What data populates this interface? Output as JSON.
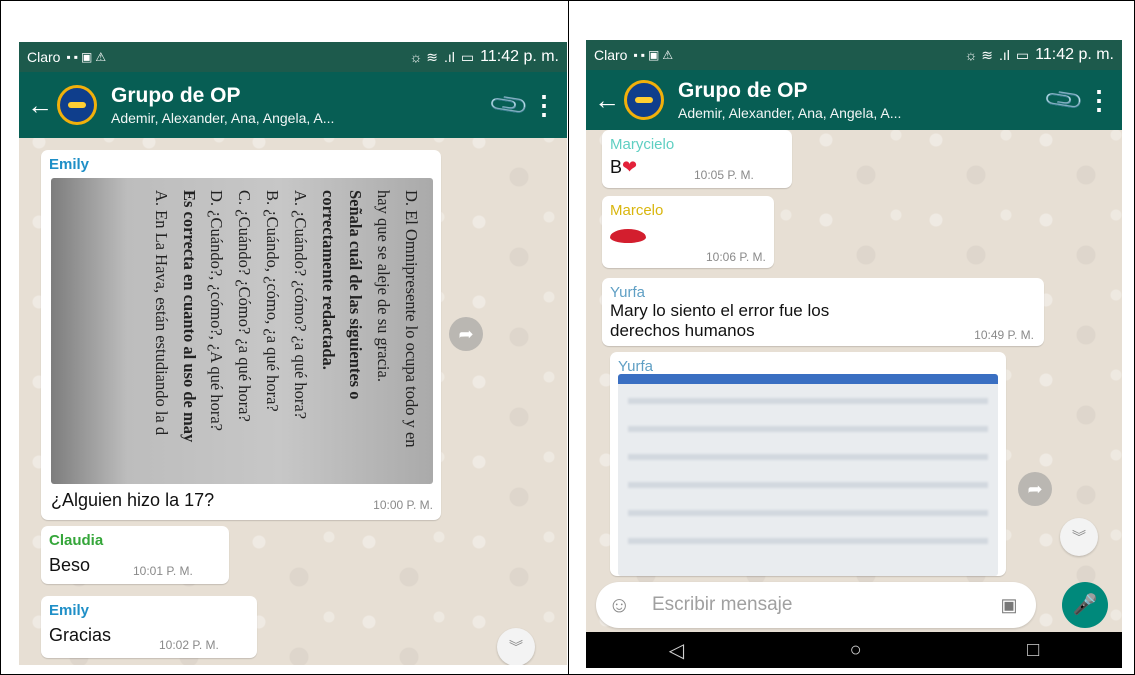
{
  "left": {
    "status": {
      "carrier": "Claro",
      "time": "11:42 p. m."
    },
    "header": {
      "title": "Grupo de OP",
      "subtitle": "Ademir, Alexander, Ana, Angela, A..."
    },
    "messages": [
      {
        "sender": "Emily",
        "sender_color": "#1f8fc7",
        "text": "¿Alguien hizo la 17?",
        "time": "10:00 P. M.",
        "image_lines": [
          "D.  El Omnipresente lo ocupa todo y en",
          "       hay que se aleje de su gracia.",
          "Señala cuál de las siguientes o",
          "correctamente redactada.",
          "A.  ¿Cuándo? ¿cómo? ¿a qué hora?",
          "B.  ¿Cuándo, ¿cómo, ¿a qué hora?",
          "C.  ¿Cuándo? ¿Cómo? ¿a qué hora?",
          "D.  ¿Cuándo?, ¿cómo?, ¿A qué hora?",
          "Es correcta en cuanto al uso de may",
          "A.  En La Hava, están estudiando la d"
        ]
      },
      {
        "sender": "Claudia",
        "sender_color": "#35a63a",
        "text": "Beso",
        "time": "10:01 P. M."
      },
      {
        "sender": "Emily",
        "sender_color": "#1f8fc7",
        "text": "Gracias",
        "time": "10:02 P. M."
      }
    ]
  },
  "right": {
    "status": {
      "carrier": "Claro",
      "time": "11:42 p. m."
    },
    "header": {
      "title": "Grupo de OP",
      "subtitle": "Ademir, Alexander, Ana, Angela, A..."
    },
    "messages": [
      {
        "sender": "Marycielo",
        "sender_color": "#5fcfc2",
        "text": "B",
        "emoji": "❤",
        "time": "10:05 P. M."
      },
      {
        "sender": "Marcelo",
        "sender_color": "#d9b60e",
        "emoji": "lips",
        "time": "10:06 P. M."
      },
      {
        "sender": "Yurfa",
        "sender_color": "#5f9fc4",
        "text_line1": "Mary lo siento el error fue los",
        "text_line2": "derechos humanos",
        "time": "10:49 P. M."
      },
      {
        "sender": "Yurfa",
        "sender_color": "#5f9fc4"
      }
    ],
    "composer": {
      "placeholder": "Escribir mensaje"
    }
  },
  "icons": {
    "status": "sim-notification-icons",
    "back": "back-arrow-icon",
    "attach": "paperclip-icon",
    "menu": "more-vert-icon",
    "forward": "forward-icon",
    "scroll": "double-chevron-down-icon",
    "emoji": "emoji-icon",
    "camera": "camera-icon",
    "mic": "mic-icon"
  },
  "colors": {
    "appbar": "#075e54",
    "statusbar": "#1d5a4c",
    "fab": "#00897b"
  }
}
